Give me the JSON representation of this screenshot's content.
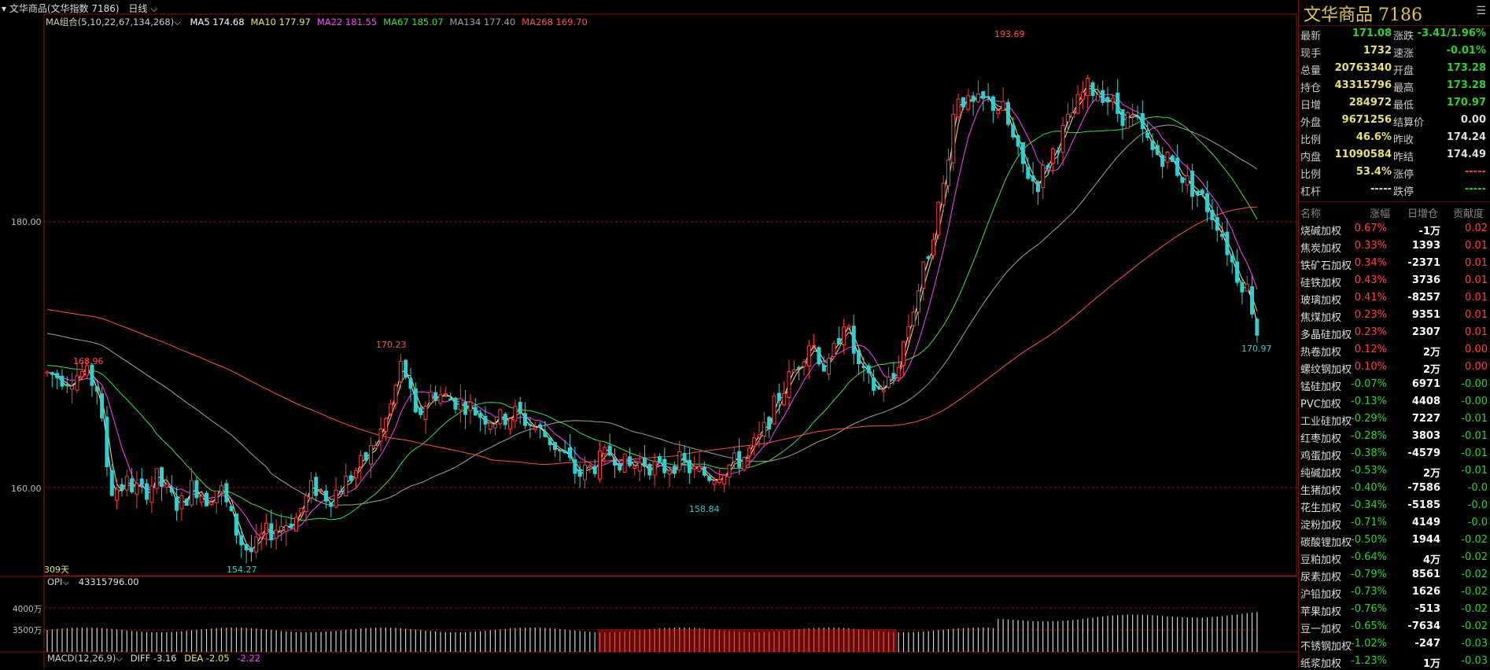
{
  "header": {
    "title": "文华商品(文华指数 7186)",
    "period": "日线",
    "ma_group": "MA组合(5,10,22,67,134,268)",
    "ma": [
      {
        "label": "MA5 174.68",
        "color": "#ffffff"
      },
      {
        "label": "MA10 177.97",
        "color": "#e8e070"
      },
      {
        "label": "MA22 181.55",
        "color": "#ff40ff"
      },
      {
        "label": "MA67 185.07",
        "color": "#40e040"
      },
      {
        "label": "MA134 177.40",
        "color": "#a0a0a0"
      },
      {
        "label": "MA268 169.70",
        "color": "#ff5050"
      }
    ]
  },
  "main_chart": {
    "y_labels": [
      "180.00",
      "160.00"
    ],
    "days_label": "309天",
    "annotations": {
      "high": "193.69",
      "p1": "170.23",
      "p2": "168.96",
      "low1": "154.27",
      "low2": "158.84",
      "last": "170.97"
    }
  },
  "opi": {
    "label": "OPI",
    "value": "43315796.00",
    "y_labels": [
      "4000万",
      "3500万"
    ]
  },
  "macd": {
    "label": "MACD(12,26,9)",
    "diff": "DIFF -3.16",
    "dea": "DEA -2.05",
    "macd": "-2.22"
  },
  "panel": {
    "title": "文华商品",
    "code": "7186",
    "quotes": [
      {
        "l1": "最新",
        "v1": "171.08",
        "c1": "#30d030",
        "l2": "涨跌",
        "v2": "-3.41/1.96%",
        "c2": "#30d030"
      },
      {
        "l1": "现手",
        "v1": "1732",
        "c1": "#e8e070",
        "l2": "速涨",
        "v2": "-0.01%",
        "c2": "#30d030"
      },
      {
        "l1": "总量",
        "v1": "20763340",
        "c1": "#e8e070",
        "l2": "开盘",
        "v2": "173.28",
        "c2": "#30d030"
      },
      {
        "l1": "持仓",
        "v1": "43315796",
        "c1": "#e8e070",
        "l2": "最高",
        "v2": "173.28",
        "c2": "#30d030"
      },
      {
        "l1": "日增",
        "v1": "284972",
        "c1": "#e8e070",
        "l2": "最低",
        "v2": "170.97",
        "c2": "#30d030"
      },
      {
        "l1": "外盘",
        "v1": "9671256",
        "c1": "#e8e070",
        "l2": "结算价",
        "v2": "0.00",
        "c2": "#dddddd"
      },
      {
        "l1": "比例",
        "v1": "46.6%",
        "c1": "#e8e070",
        "l2": "昨收",
        "v2": "174.24",
        "c2": "#dddddd"
      },
      {
        "l1": "内盘",
        "v1": "11090584",
        "c1": "#e8e070",
        "l2": "昨结",
        "v2": "174.49",
        "c2": "#dddddd"
      },
      {
        "l1": "比例",
        "v1": "53.4%",
        "c1": "#e8e070",
        "l2": "涨停",
        "v2": "-----",
        "c2": "#ff4040"
      },
      {
        "l1": "杠杆",
        "v1": "-----",
        "c1": "#dddddd",
        "l2": "跌停",
        "v2": "-----",
        "c2": "#30d030"
      }
    ],
    "table_headers": [
      "名称",
      "涨幅",
      "日增仓",
      "贡献度"
    ],
    "table": [
      {
        "name": "烧碱加权",
        "chg": "0.67%",
        "oi": "-1万",
        "con": "0.02"
      },
      {
        "name": "焦炭加权",
        "chg": "0.33%",
        "oi": "1393",
        "con": "0.01"
      },
      {
        "name": "铁矿石加权",
        "chg": "0.34%",
        "oi": "-2371",
        "con": "0.01"
      },
      {
        "name": "硅铁加权",
        "chg": "0.43%",
        "oi": "3736",
        "con": "0.01"
      },
      {
        "name": "玻璃加权",
        "chg": "0.41%",
        "oi": "-8257",
        "con": "0.01"
      },
      {
        "name": "焦煤加权",
        "chg": "0.23%",
        "oi": "9351",
        "con": "0.01"
      },
      {
        "name": "多晶硅加权",
        "chg": "0.23%",
        "oi": "2307",
        "con": "0.01"
      },
      {
        "name": "热卷加权",
        "chg": "0.12%",
        "oi": "2万",
        "con": "0.00"
      },
      {
        "name": "螺纹钢加权",
        "chg": "0.10%",
        "oi": "2万",
        "con": "0.00"
      },
      {
        "name": "锰硅加权",
        "chg": "-0.07%",
        "oi": "6971",
        "con": "-0.00"
      },
      {
        "name": "PVC加权",
        "chg": "-0.13%",
        "oi": "4408",
        "con": "-0.00"
      },
      {
        "name": "工业硅加权",
        "chg": "-0.29%",
        "oi": "7227",
        "con": "-0.01"
      },
      {
        "name": "红枣加权",
        "chg": "-0.28%",
        "oi": "3803",
        "con": "-0.01"
      },
      {
        "name": "鸡蛋加权",
        "chg": "-0.38%",
        "oi": "-4579",
        "con": "-0.01"
      },
      {
        "name": "纯碱加权",
        "chg": "-0.53%",
        "oi": "2万",
        "con": "-0.01"
      },
      {
        "name": "生猪加权",
        "chg": "-0.40%",
        "oi": "-7586",
        "con": "-0.0"
      },
      {
        "name": "花生加权",
        "chg": "-0.34%",
        "oi": "-5185",
        "con": "-0.0"
      },
      {
        "name": "淀粉加权",
        "chg": "-0.71%",
        "oi": "4149",
        "con": "-0.0"
      },
      {
        "name": "碳酸锂加权",
        "chg": "-0.50%",
        "oi": "1944",
        "con": "-0.02"
      },
      {
        "name": "豆粕加权",
        "chg": "-0.64%",
        "oi": "4万",
        "con": "-0.02"
      },
      {
        "name": "尿素加权",
        "chg": "-0.79%",
        "oi": "8561",
        "con": "-0.02"
      },
      {
        "name": "沪铅加权",
        "chg": "-0.73%",
        "oi": "1626",
        "con": "-0.02"
      },
      {
        "name": "苹果加权",
        "chg": "-0.76%",
        "oi": "-513",
        "con": "-0.02"
      },
      {
        "name": "豆一加权",
        "chg": "-0.65%",
        "oi": "-7634",
        "con": "-0.02"
      },
      {
        "name": "不锈钢加权",
        "chg": "-1.02%",
        "oi": "-247",
        "con": "-0.03"
      },
      {
        "name": "纸浆加权",
        "chg": "-1.23%",
        "oi": "1万",
        "con": "-0.03"
      }
    ]
  }
}
